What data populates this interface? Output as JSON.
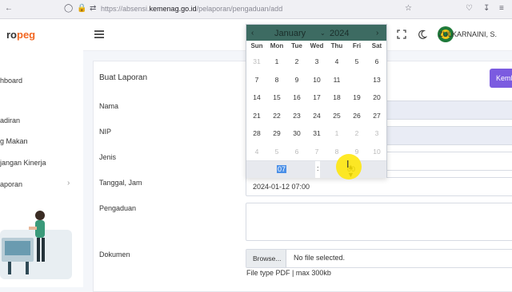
{
  "browser": {
    "url_prefix": "https://absensi.",
    "url_domain": "kemenag.go.id",
    "url_path": "/pelaporan/pengaduan/add"
  },
  "sidebar": {
    "logo_text": "ro",
    "logo_accent": "peg",
    "items": [
      {
        "label": "hboard"
      },
      {
        "label": "adiran"
      },
      {
        "label": "g Makan"
      },
      {
        "label": "jangan Kinerja"
      },
      {
        "label": "aporan"
      }
    ]
  },
  "header": {
    "user_name": "ZULKARNAINI, S."
  },
  "form": {
    "title": "Buat Laporan",
    "add_button": "Kemb",
    "labels": {
      "nama": "Nama",
      "nip": "NIP",
      "jenis": "Jenis",
      "tanggal": "Tanggal, Jam",
      "pengaduan": "Pengaduan",
      "dokumen": "Dokumen"
    },
    "tanggal_value": "2024-01-12 07:00",
    "browse_label": "Browse...",
    "file_status": "No file selected.",
    "file_hint": "File type PDF | max 300kb"
  },
  "datepicker": {
    "month": "January",
    "year": "2024",
    "weekdays": [
      "Sun",
      "Mon",
      "Tue",
      "Wed",
      "Thu",
      "Fri",
      "Sat"
    ],
    "days": [
      [
        "31",
        "1",
        "2",
        "3",
        "4",
        "5",
        "6"
      ],
      [
        "7",
        "8",
        "9",
        "10",
        "11",
        "12",
        "13"
      ],
      [
        "14",
        "15",
        "16",
        "17",
        "18",
        "19",
        "20"
      ],
      [
        "21",
        "22",
        "23",
        "24",
        "25",
        "26",
        "27"
      ],
      [
        "28",
        "29",
        "30",
        "31",
        "1",
        "2",
        "3"
      ],
      [
        "4",
        "5",
        "6",
        "7",
        "8",
        "9",
        "10"
      ]
    ],
    "selected_day": "12",
    "hour": "07",
    "minute": "00"
  },
  "colors": {
    "accent": "#7b5be0",
    "header_green": "#3d6b62",
    "selected_blue": "#4a8fe7",
    "logo_orange": "#f26722"
  }
}
